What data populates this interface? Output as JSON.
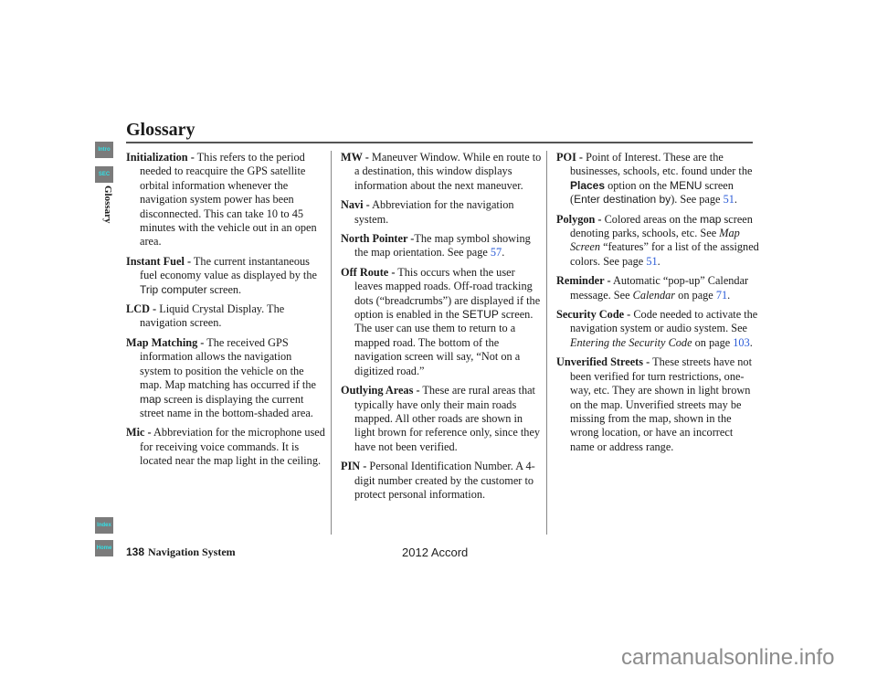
{
  "page": {
    "title": "Glossary",
    "side_label": "Glossary",
    "page_number": "138",
    "footer_title": "Navigation System",
    "model": "2012 Accord",
    "watermark": "carmanualsonline.info"
  },
  "nav_buttons": [
    {
      "label": "Intro"
    },
    {
      "label": "SEC"
    },
    {
      "label": "Index"
    },
    {
      "label": "Home"
    }
  ],
  "entries": {
    "initialization": {
      "term": "Initialization -",
      "text": " This refers to the period needed to reacquire the GPS satellite orbital information whenever the navigation system power has been disconnected. This can take 10 to 45 minutes with the vehicle out in an open area."
    },
    "instant_fuel": {
      "term": "Instant Fuel -",
      "text1": " The current instantaneous fuel economy value as displayed by the ",
      "ui": "Trip computer",
      "text2": " screen."
    },
    "lcd": {
      "term": "LCD -",
      "text": " Liquid Crystal Display. The navigation screen."
    },
    "map_matching": {
      "term": "Map Matching -",
      "text1": " The received GPS information allows the navigation system to position the vehicle on the map. Map matching has occurred if the ",
      "ui": "map",
      "text2": " screen is displaying the current street name in the bottom-shaded area."
    },
    "mic": {
      "term": "Mic -",
      "text": " Abbreviation for the microphone used for receiving voice commands. It is located near the map light in the ceiling."
    },
    "mw": {
      "term": "MW -",
      "text": " Maneuver Window. While en route to a destination, this window displays information about the next maneuver."
    },
    "navi": {
      "term": "Navi -",
      "text": " Abbreviation for the navigation system."
    },
    "north_pointer": {
      "term": "North Pointer -",
      "text": "The map symbol showing the map orientation. See page ",
      "link": "57",
      "end": "."
    },
    "off_route": {
      "term": "Off Route -",
      "text1": " This occurs when the user leaves mapped roads. Off-road tracking dots (“breadcrumbs”) are displayed if the option is enabled in the ",
      "ui": "SETUP",
      "text2": " screen. The user can use them to return to a mapped road. The bottom of the navigation screen will say, “Not on a digitized road.”"
    },
    "outlying_areas": {
      "term": "Outlying Areas -",
      "text": " These are rural areas that typically have only their main roads mapped. All other roads are shown in light brown for reference only, since they have not been verified."
    },
    "pin": {
      "term": "PIN -",
      "text": " Personal Identification Number. A 4-digit number created by the customer to protect personal information."
    },
    "poi": {
      "term": "POI -",
      "text1": " Point of Interest. These are the businesses, schools, etc. found under the ",
      "ui_bold": "Places",
      "text2": " option on the ",
      "ui": "MENU",
      "text3": " screen (",
      "ui2": "Enter destination by",
      "text4": "). See page ",
      "link": "51",
      "end": "."
    },
    "polygon": {
      "term": "Polygon -",
      "text1": " Colored areas on the ",
      "ui": "map",
      "text2": " screen denoting parks, schools, etc. See ",
      "italic": "Map Screen",
      "text3": " “features” for a list of the assigned colors. See page ",
      "link": "51",
      "end": "."
    },
    "reminder": {
      "term": "Reminder -",
      "text1": " Automatic “pop-up” Calendar message. See ",
      "italic": "Calendar",
      "text2": " on page ",
      "link": "71",
      "end": "."
    },
    "security_code": {
      "term": "Security Code -",
      "text1": " Code needed to activate the navigation system or audio system. See ",
      "italic": "Entering the Security Code",
      "text2": " on page ",
      "link": "103",
      "end": "."
    },
    "unverified_streets": {
      "term": "Unverified Streets -",
      "text": " These streets have not been verified for turn restrictions, one-way, etc. They are shown in light brown on the map. Unverified streets may be missing from the map, shown in the wrong location, or have an incorrect name or address range."
    }
  }
}
